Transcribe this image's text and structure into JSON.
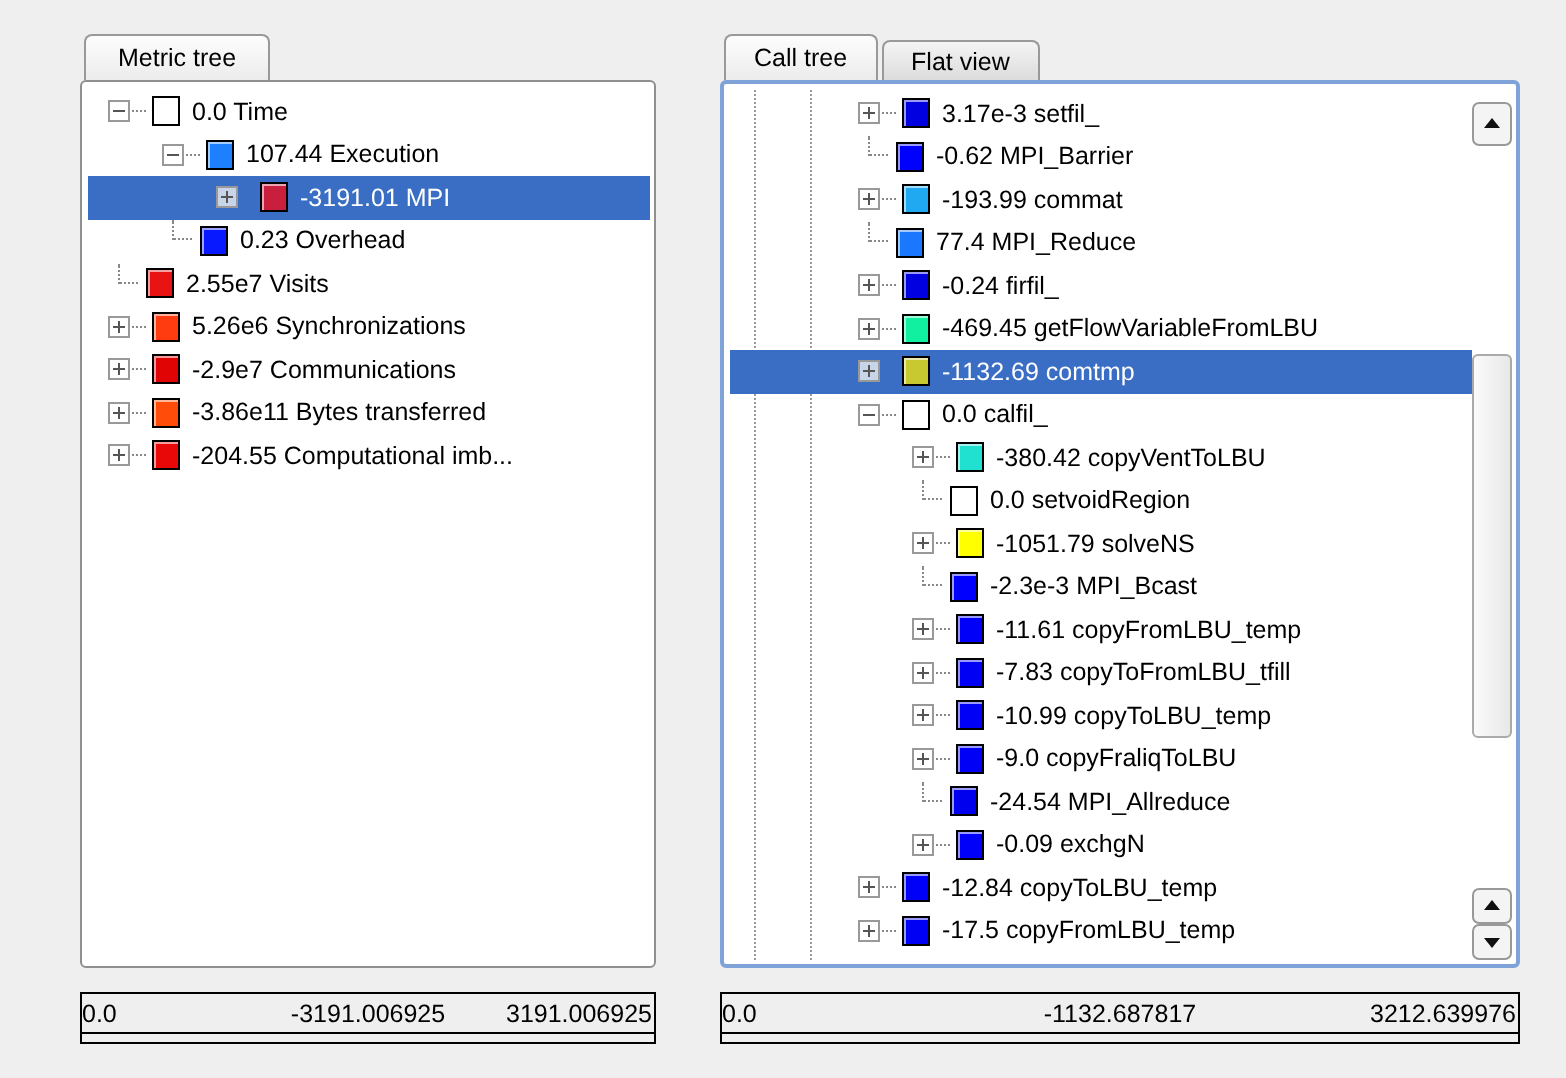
{
  "metric_panel": {
    "tabs": [
      {
        "label": "Metric tree",
        "selected": true
      }
    ],
    "tree": [
      {
        "label": "0.0 Time",
        "color": "#ffffff",
        "kind": "expanded",
        "selected": false,
        "children": [
          {
            "label": "107.44 Execution",
            "color": "#1e80ff",
            "kind": "expanded",
            "selected": false,
            "children": [
              {
                "label": "-3191.01 MPI",
                "color": "#c8203c",
                "kind": "collapsed",
                "selected": true
              }
            ]
          },
          {
            "label": "0.23 Overhead",
            "color": "#0818ff",
            "kind": "leaf",
            "selected": false
          }
        ]
      },
      {
        "label": "2.55e7 Visits",
        "color": "#e81414",
        "kind": "leaf",
        "selected": false
      },
      {
        "label": "5.26e6 Synchronizations",
        "color": "#ff3c10",
        "kind": "collapsed",
        "selected": false
      },
      {
        "label": "-2.9e7 Communications",
        "color": "#e00404",
        "kind": "collapsed",
        "selected": false
      },
      {
        "label": "-3.86e11 Bytes transferred",
        "color": "#ff4c08",
        "kind": "collapsed",
        "selected": false
      },
      {
        "label": "-204.55 Computational imb...",
        "color": "#e80808",
        "kind": "collapsed",
        "selected": false
      }
    ],
    "scale": {
      "min": "0.0",
      "value": "-3191.006925",
      "max": "3191.006925"
    }
  },
  "call_panel": {
    "tabs": [
      {
        "label": "Call tree",
        "selected": true
      },
      {
        "label": "Flat view",
        "selected": false
      }
    ],
    "tree": [
      {
        "label": "3.17e-3 setfil_",
        "color": "#0000e0",
        "kind": "collapsed",
        "selected": false
      },
      {
        "label": "-0.62 MPI_Barrier",
        "color": "#0000ff",
        "kind": "leaf",
        "selected": false
      },
      {
        "label": "-193.99 commat",
        "color": "#20a8f0",
        "kind": "collapsed",
        "selected": false
      },
      {
        "label": "77.4 MPI_Reduce",
        "color": "#1a78ff",
        "kind": "leaf",
        "selected": false
      },
      {
        "label": "-0.24 firfil_",
        "color": "#0000e0",
        "kind": "collapsed",
        "selected": false
      },
      {
        "label": "-469.45 getFlowVariableFromLBU",
        "color": "#10f0a0",
        "kind": "collapsed",
        "selected": false
      },
      {
        "label": "-1132.69 comtmp",
        "color": "#c8c830",
        "kind": "collapsed",
        "selected": true
      },
      {
        "label": "0.0 calfil_",
        "color": "#ffffff",
        "kind": "expanded",
        "selected": false,
        "children": [
          {
            "label": "-380.42 copyVentToLBU",
            "color": "#20e0d0",
            "kind": "collapsed",
            "selected": false
          },
          {
            "label": "0.0 setvoidRegion",
            "color": "#ffffff",
            "kind": "leaf",
            "selected": false
          },
          {
            "label": "-1051.79 solveNS",
            "color": "#ffff00",
            "kind": "collapsed",
            "selected": false
          },
          {
            "label": "-2.3e-3 MPI_Bcast",
            "color": "#0000ff",
            "kind": "leaf",
            "selected": false
          },
          {
            "label": "-11.61 copyFromLBU_temp",
            "color": "#0000f8",
            "kind": "collapsed",
            "selected": false
          },
          {
            "label": "-7.83 copyToFromLBU_tfill",
            "color": "#0000f4",
            "kind": "collapsed",
            "selected": false
          },
          {
            "label": "-10.99 copyToLBU_temp",
            "color": "#0000f6",
            "kind": "collapsed",
            "selected": false
          },
          {
            "label": "-9.0 copyFraliqToLBU",
            "color": "#0000f7",
            "kind": "collapsed",
            "selected": false
          },
          {
            "label": "-24.54 MPI_Allreduce",
            "color": "#0000ee",
            "kind": "leaf",
            "selected": false
          },
          {
            "label": "-0.09 exchgN",
            "color": "#0000fa",
            "kind": "collapsed",
            "selected": false
          }
        ]
      },
      {
        "label": "-12.84 copyToLBU_temp",
        "color": "#0000f9",
        "kind": "collapsed",
        "selected": false
      },
      {
        "label": "-17.5 copyFromLBU_temp",
        "color": "#0000f5",
        "kind": "collapsed",
        "selected": false
      }
    ],
    "scale": {
      "min": "0.0",
      "value": "-1132.687817",
      "max": "3212.639976"
    }
  }
}
